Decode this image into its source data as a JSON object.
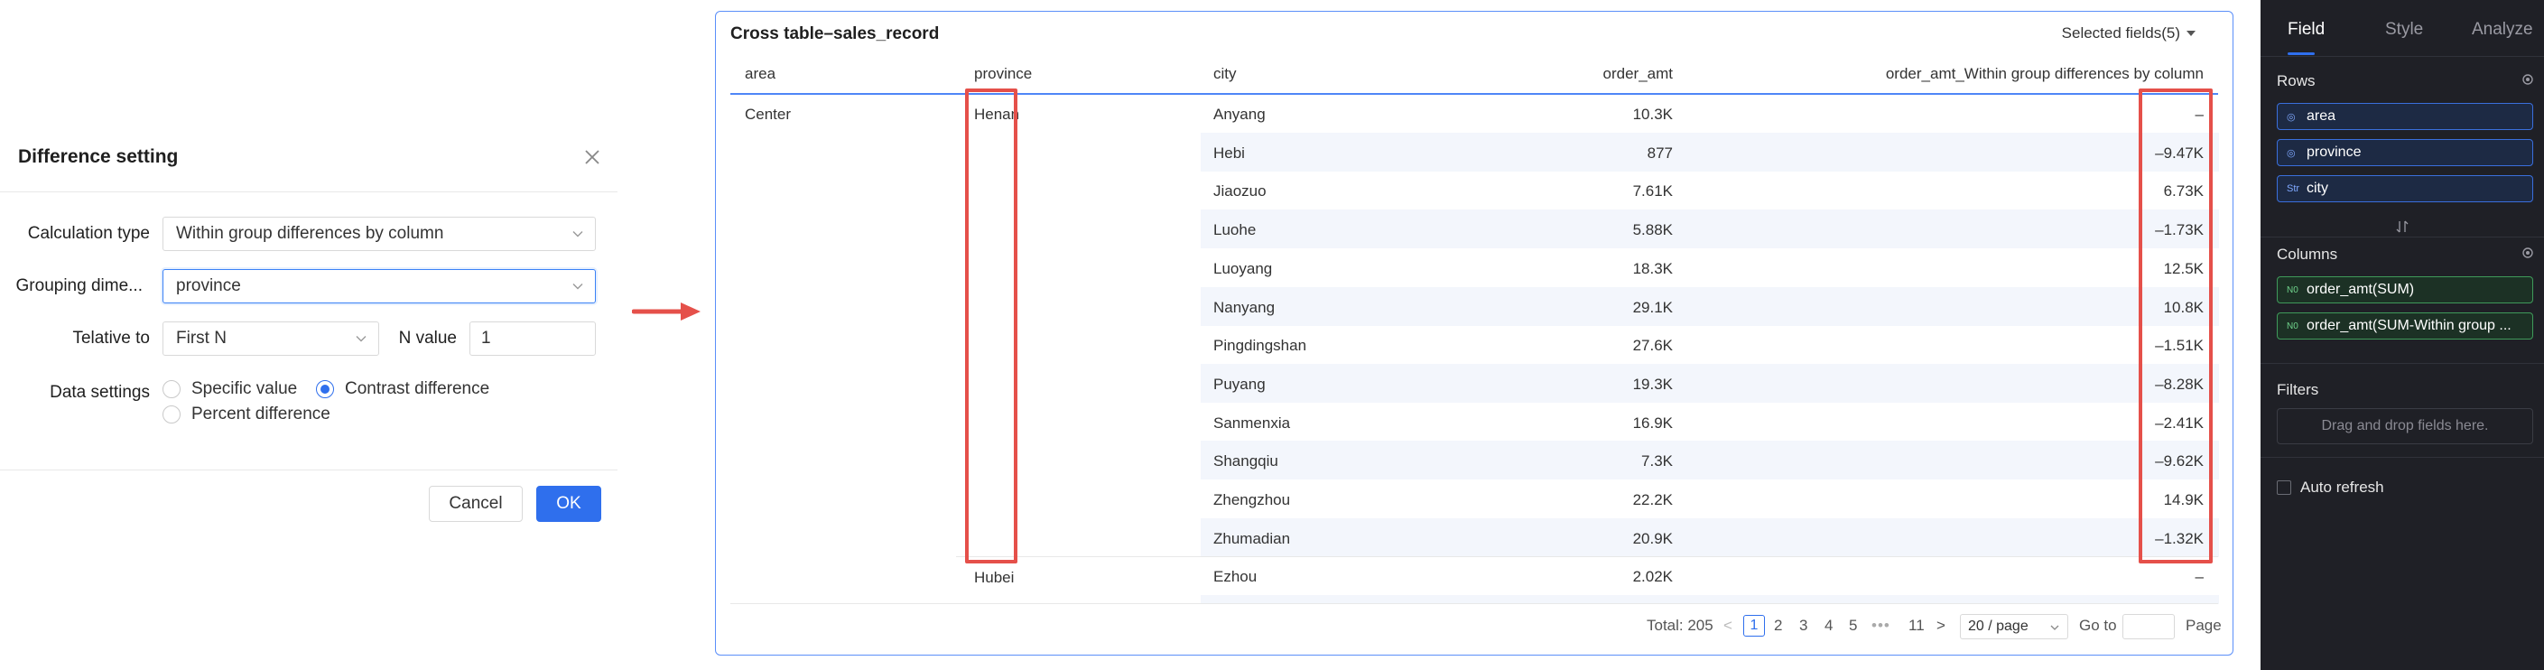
{
  "dialog": {
    "title": "Difference setting",
    "calc_type_label": "Calculation type",
    "calc_type_value": "Within group differences by column",
    "grouping_label": "Grouping dime...",
    "grouping_value": "province",
    "relative_label": "Telative to",
    "relative_value": "First N",
    "n_value_label": "N value",
    "n_value": "1",
    "data_settings_label": "Data settings",
    "radio_specific": "Specific value",
    "radio_contrast": "Contrast difference",
    "radio_percent": "Percent difference",
    "selected_radio": "Contrast difference",
    "cancel_label": "Cancel",
    "ok_label": "OK"
  },
  "table": {
    "title": "Cross table–sales_record",
    "selected_fields": "Selected fields(5)",
    "columns": [
      "area",
      "province",
      "city",
      "order_amt",
      "order_amt_Within group differences by column"
    ],
    "area": "Center",
    "province_1": "Henan",
    "province_2": "Hubei",
    "rows": [
      {
        "city": "Anyang",
        "amt": "10.3K",
        "diff": "–"
      },
      {
        "city": "Hebi",
        "amt": "877",
        "diff": "–9.47K"
      },
      {
        "city": "Jiaozuo",
        "amt": "7.61K",
        "diff": "6.73K"
      },
      {
        "city": "Luohe",
        "amt": "5.88K",
        "diff": "–1.73K"
      },
      {
        "city": "Luoyang",
        "amt": "18.3K",
        "diff": "12.5K"
      },
      {
        "city": "Nanyang",
        "amt": "29.1K",
        "diff": "10.8K"
      },
      {
        "city": "Pingdingshan",
        "amt": "27.6K",
        "diff": "–1.51K"
      },
      {
        "city": "Puyang",
        "amt": "19.3K",
        "diff": "–8.28K"
      },
      {
        "city": "Sanmenxia",
        "amt": "16.9K",
        "diff": "–2.41K"
      },
      {
        "city": "Shangqiu",
        "amt": "7.3K",
        "diff": "–9.62K"
      },
      {
        "city": "Zhengzhou",
        "amt": "22.2K",
        "diff": "14.9K"
      },
      {
        "city": "Zhumadian",
        "amt": "20.9K",
        "diff": "–1.32K"
      },
      {
        "city": "Ezhou",
        "amt": "2.02K",
        "diff": "–"
      }
    ],
    "pagination": {
      "total": "Total: 205",
      "prev": "<",
      "pages": [
        "1",
        "2",
        "3",
        "4",
        "5"
      ],
      "ellipsis": "•••",
      "last": "11",
      "next": ">",
      "page_size": "20 / page",
      "goto_label": "Go to",
      "page_label": "Page"
    }
  },
  "sidebar": {
    "tabs": [
      "Field",
      "Style",
      "Analyze"
    ],
    "active_tab": "Field",
    "rows_title": "Rows",
    "row_fields": [
      "area",
      "province",
      "city"
    ],
    "row_field_badges": [
      "◎",
      "◎",
      "Str"
    ],
    "columns_title": "Columns",
    "column_fields": [
      "order_amt(SUM)",
      "order_amt(SUM-Within group ..."
    ],
    "column_field_badge": "N0",
    "filters_title": "Filters",
    "filters_placeholder": "Drag and drop fields here.",
    "auto_refresh_label": "Auto refresh"
  },
  "colors": {
    "accent": "#2f6fed",
    "highlight": "#e5504a",
    "sidebar_bg": "#1f2026"
  }
}
